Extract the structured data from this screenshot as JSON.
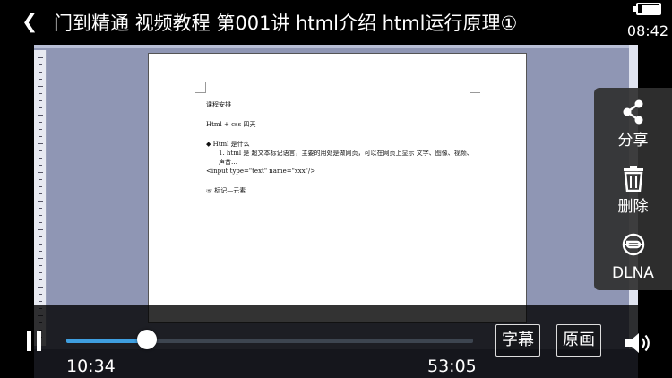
{
  "header": {
    "back_glyph": "❮",
    "title": "门到精通 视频教程 第001讲  html介绍 html运行原理①",
    "clock": "08:42",
    "battery_level": 0.85
  },
  "video_document": {
    "lines": [
      "课程安排",
      "Html + css  四天",
      "◆    Html 是什么",
      "1.    html  是  超文本标记语言，主要的用处是做网页，可以在网页上显示  文字、图像、视频、声音…",
      "<input type=\"text\" name=\"xxx\"/>",
      "☞  标记—元素"
    ]
  },
  "side_menu": {
    "items": [
      {
        "label": "分享",
        "icon": "share-icon"
      },
      {
        "label": "删除",
        "icon": "trash-icon"
      },
      {
        "label": "DLNA",
        "icon": "dlna-icon"
      }
    ]
  },
  "player": {
    "current_time": "10:34",
    "total_time": "53:05",
    "progress": 0.199,
    "subtitle_label": "字幕",
    "quality_label": "原画",
    "accent_color": "#3f9fe0"
  }
}
